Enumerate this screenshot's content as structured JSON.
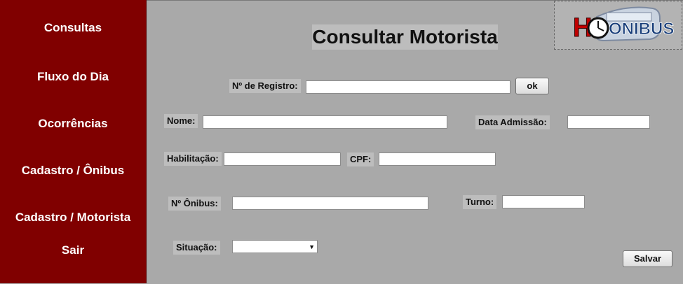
{
  "sidebar": {
    "items": [
      {
        "label": "Consultas"
      },
      {
        "label": "Fluxo do Dia"
      },
      {
        "label": "Ocorrências"
      },
      {
        "label": "Cadastro / Ônibus"
      },
      {
        "label": "Cadastro / Motorista"
      },
      {
        "label": "Sair"
      }
    ]
  },
  "logo": {
    "text": "ONIBUS",
    "initial": "H"
  },
  "page": {
    "title": "Consultar Motorista"
  },
  "form": {
    "registro": {
      "label": "Nº de Registro:",
      "value": ""
    },
    "ok_label": "ok",
    "nome": {
      "label": "Nome:",
      "value": ""
    },
    "data_admissao": {
      "label": "Data Admissão:",
      "value": ""
    },
    "habilitacao": {
      "label": "Habilitação:",
      "value": ""
    },
    "cpf": {
      "label": "CPF:",
      "value": ""
    },
    "onibus": {
      "label": "Nº Ônibus:",
      "value": ""
    },
    "turno": {
      "label": "Turno:",
      "value": ""
    },
    "situacao": {
      "label": "Situação:",
      "value": ""
    },
    "save_label": "Salvar"
  },
  "colors": {
    "sidebar": "#800000",
    "background": "#a9a9a9",
    "label_bg": "#bdbdbd"
  }
}
